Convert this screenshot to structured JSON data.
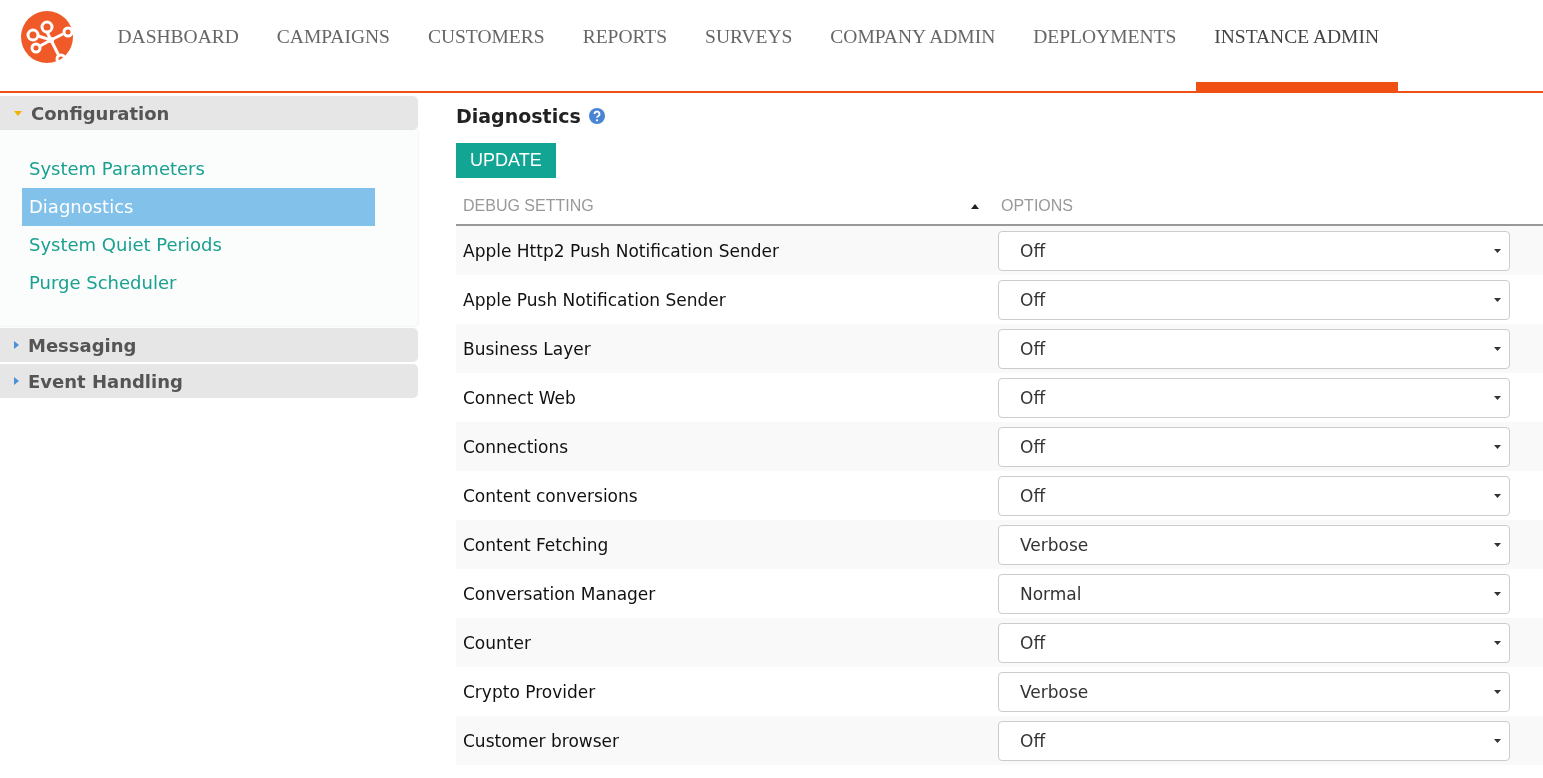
{
  "nav": [
    {
      "label": "DASHBOARD",
      "selected": false
    },
    {
      "label": "CAMPAIGNS",
      "selected": false
    },
    {
      "label": "CUSTOMERS",
      "selected": false
    },
    {
      "label": "REPORTS",
      "selected": false
    },
    {
      "label": "SURVEYS",
      "selected": false
    },
    {
      "label": "COMPANY ADMIN",
      "selected": false
    },
    {
      "label": "DEPLOYMENTS",
      "selected": false
    },
    {
      "label": "INSTANCE ADMIN",
      "selected": true
    }
  ],
  "sidebar": {
    "sections": [
      {
        "title": "Configuration",
        "expanded": true,
        "items": [
          {
            "label": "System Parameters",
            "selected": false
          },
          {
            "label": "Diagnostics",
            "selected": true
          },
          {
            "label": "System Quiet Periods",
            "selected": false
          },
          {
            "label": "Purge Scheduler",
            "selected": false
          }
        ]
      },
      {
        "title": "Messaging",
        "expanded": false
      },
      {
        "title": "Event Handling",
        "expanded": false
      }
    ]
  },
  "page": {
    "title": "Diagnostics",
    "update_button": "UPDATE"
  },
  "table": {
    "columns": [
      "DEBUG SETTING",
      "OPTIONS"
    ],
    "rows": [
      {
        "setting": "Apple Http2 Push Notification Sender",
        "option": "Off"
      },
      {
        "setting": "Apple Push Notification Sender",
        "option": "Off"
      },
      {
        "setting": "Business Layer",
        "option": "Off"
      },
      {
        "setting": "Connect Web",
        "option": "Off"
      },
      {
        "setting": "Connections",
        "option": "Off"
      },
      {
        "setting": "Content conversions",
        "option": "Off"
      },
      {
        "setting": "Content Fetching",
        "option": "Verbose"
      },
      {
        "setting": "Conversation Manager",
        "option": "Normal"
      },
      {
        "setting": "Counter",
        "option": "Off"
      },
      {
        "setting": "Crypto Provider",
        "option": "Verbose"
      },
      {
        "setting": "Customer browser",
        "option": "Off"
      }
    ]
  }
}
